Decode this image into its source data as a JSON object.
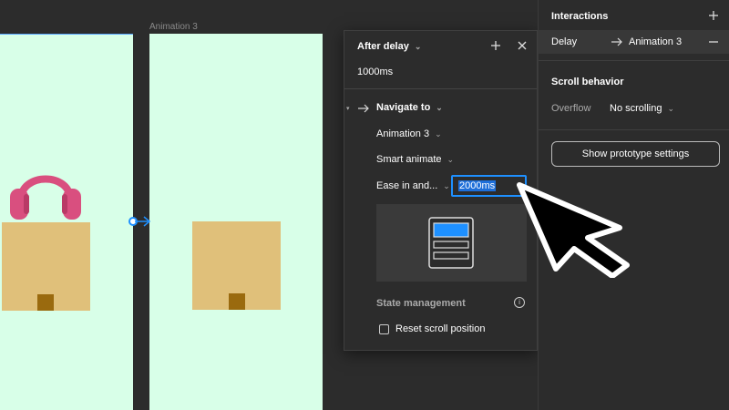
{
  "canvas": {
    "frame_right_title": "Animation 3",
    "frame_bg": "#d8ffe8",
    "headphone_color": "#d94f7f"
  },
  "popup": {
    "trigger": "After delay",
    "delay_value": "1000ms",
    "action": "Navigate to",
    "destination": "Animation 3",
    "animation": "Smart animate",
    "easing": "Ease in and...",
    "duration": "2000ms",
    "state_management": "State management",
    "reset_scroll": "Reset scroll position",
    "accent": "#1e90ff"
  },
  "panel": {
    "interactions_title": "Interactions",
    "delay_label": "Delay",
    "delay_target": "Animation 3",
    "scroll_title": "Scroll behavior",
    "overflow_label": "Overflow",
    "overflow_value": "No scrolling",
    "proto_button": "Show prototype settings"
  },
  "icons": [
    "plus-icon",
    "close-icon",
    "arrow-right-icon",
    "minus-icon",
    "chevron-down-icon",
    "info-icon",
    "headphones-icon",
    "cursor-icon"
  ]
}
